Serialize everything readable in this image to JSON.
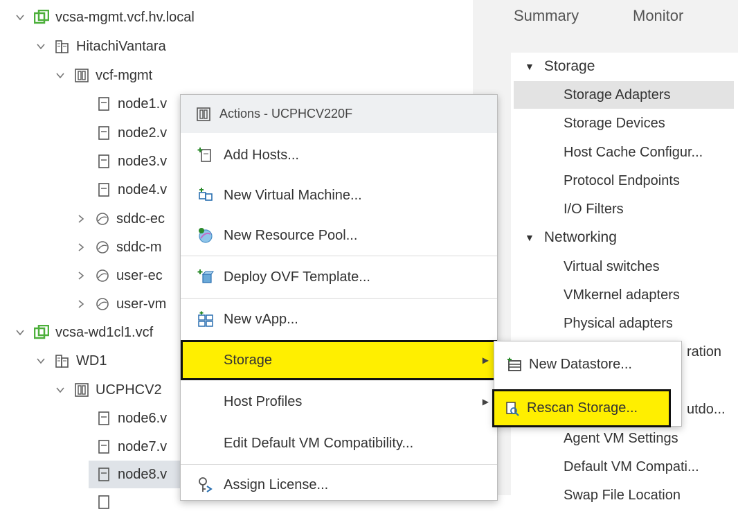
{
  "tree": {
    "items": [
      {
        "label": "vcsa-mgmt.vcf.hv.local",
        "icon": "vcenter-icon",
        "chevron": "down"
      },
      {
        "label": "HitachiVantara",
        "icon": "datacenter-icon",
        "chevron": "down"
      },
      {
        "label": "vcf-mgmt",
        "icon": "cluster-icon",
        "chevron": "down"
      },
      {
        "label": "node1.v",
        "icon": "host-icon",
        "chevron": ""
      },
      {
        "label": "node2.v",
        "icon": "host-icon",
        "chevron": ""
      },
      {
        "label": "node3.v",
        "icon": "host-icon",
        "chevron": ""
      },
      {
        "label": "node4.v",
        "icon": "host-icon",
        "chevron": ""
      },
      {
        "label": "sddc-ec",
        "icon": "resource-pool-icon",
        "chevron": "right"
      },
      {
        "label": "sddc-m",
        "icon": "resource-pool-icon",
        "chevron": "right"
      },
      {
        "label": "user-ec",
        "icon": "resource-pool-icon",
        "chevron": "right"
      },
      {
        "label": "user-vm",
        "icon": "resource-pool-icon",
        "chevron": "right"
      },
      {
        "label": "vcsa-wd1cl1.vcf",
        "icon": "vcenter-icon",
        "chevron": "down"
      },
      {
        "label": "WD1",
        "icon": "datacenter-icon",
        "chevron": "down"
      },
      {
        "label": "UCPHCV2",
        "icon": "cluster-icon",
        "chevron": "down"
      },
      {
        "label": "node6.v",
        "icon": "host-icon",
        "chevron": ""
      },
      {
        "label": "node7.v",
        "icon": "host-icon",
        "chevron": ""
      },
      {
        "label": "node8.v",
        "icon": "host-icon",
        "chevron": ""
      }
    ]
  },
  "right_panel": {
    "tabs": [
      "Summary",
      "Monitor"
    ],
    "nav": [
      {
        "label": "Storage",
        "header": true
      },
      {
        "label": "Storage Adapters",
        "highlight": true
      },
      {
        "label": "Storage Devices"
      },
      {
        "label": "Host Cache Configur..."
      },
      {
        "label": "Protocol Endpoints"
      },
      {
        "label": "I/O Filters"
      },
      {
        "label": "Networking",
        "header": true
      },
      {
        "label": "Virtual switches"
      },
      {
        "label": "VMkernel adapters"
      },
      {
        "label": "Physical adapters"
      },
      {
        "label": "ration"
      },
      {
        "label": ""
      },
      {
        "label": "utdo..."
      },
      {
        "label": "Agent VM Settings"
      },
      {
        "label": "Default VM Compati..."
      },
      {
        "label": "Swap File Location"
      }
    ]
  },
  "context_menu": {
    "title": "Actions - UCPHCV220F",
    "items": [
      {
        "label": "Add Hosts...",
        "icon": "add-host-icon"
      },
      {
        "label": "New Virtual Machine...",
        "icon": "new-vm-icon"
      },
      {
        "label": "New Resource Pool...",
        "icon": "new-resource-pool-icon"
      },
      {
        "label": "Deploy OVF Template...",
        "icon": "deploy-ovf-icon"
      },
      {
        "label": "New vApp...",
        "icon": "new-vapp-icon"
      },
      {
        "label": "Storage",
        "icon": "",
        "submenu": true,
        "highlight": true
      },
      {
        "label": "Host Profiles",
        "icon": "",
        "submenu": true
      },
      {
        "label": "Edit Default VM Compatibility...",
        "icon": ""
      },
      {
        "label": "Assign License...",
        "icon": "assign-license-icon"
      }
    ]
  },
  "storage_submenu": {
    "items": [
      {
        "label": "New Datastore...",
        "icon": "new-datastore-icon"
      },
      {
        "label": "Rescan Storage...",
        "icon": "rescan-storage-icon",
        "highlight": true
      }
    ]
  },
  "colors": {
    "highlight_yellow": "#ffef00",
    "vcenter_green": "#4caf3a",
    "selected_row": "#dfe3e8"
  }
}
